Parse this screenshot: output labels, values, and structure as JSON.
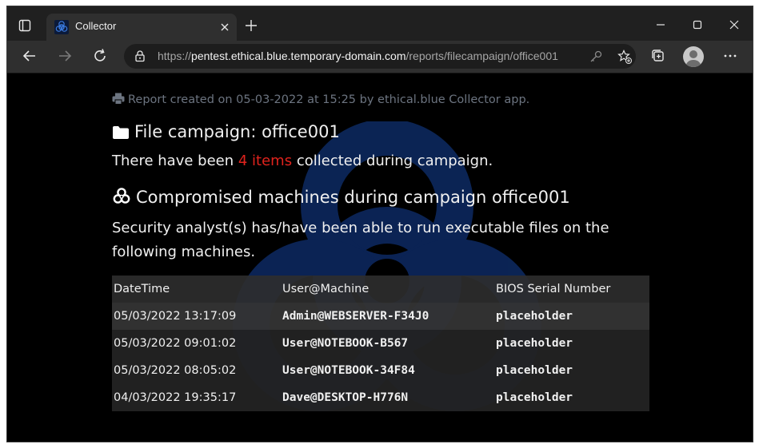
{
  "browser": {
    "tab_title": "Collector",
    "url_prefix": "https://",
    "url_host": "pentest.ethical.blue.temporary-domain.com",
    "url_path": "/reports/filecampaign/office001"
  },
  "report": {
    "created_text": "Report created on 05-03-2022 at 15:25 by ethical.blue Collector app.",
    "campaign_heading": "File campaign: office001",
    "items_prefix": "There have been ",
    "items_count": "4 items",
    "items_suffix": " collected during campaign.",
    "compromised_heading": "Compromised machines during campaign office001",
    "analyst_text": "Security analyst(s) has/have been able to run executable files on the following machines."
  },
  "table": {
    "headers": [
      "DateTime",
      "User@Machine",
      "BIOS Serial Number"
    ],
    "rows": [
      [
        "05/03/2022 13:17:09",
        "Admin@WEBSERVER-F34J0",
        "placeholder"
      ],
      [
        "05/03/2022 09:01:02",
        "User@NOTEBOOK-B567",
        "placeholder"
      ],
      [
        "05/03/2022 08:05:02",
        "User@NOTEBOOK-34F84",
        "placeholder"
      ],
      [
        "04/03/2022 19:35:17",
        "Dave@DESKTOP-H776N",
        "placeholder"
      ]
    ]
  },
  "colors": {
    "accent_red": "#e0231d",
    "page_bg": "#000000",
    "muted_text": "#6c7480"
  },
  "icons": [
    "tab-actions-icon",
    "biohazard-favicon-icon",
    "close-icon",
    "plus-icon",
    "minimize-icon",
    "maximize-icon",
    "back-arrow-icon",
    "forward-arrow-icon",
    "refresh-icon",
    "lock-icon",
    "key-icon",
    "favorite-star-icon",
    "collections-icon",
    "profile-icon",
    "more-icon",
    "print-icon",
    "folder-icon",
    "biohazard-icon"
  ]
}
